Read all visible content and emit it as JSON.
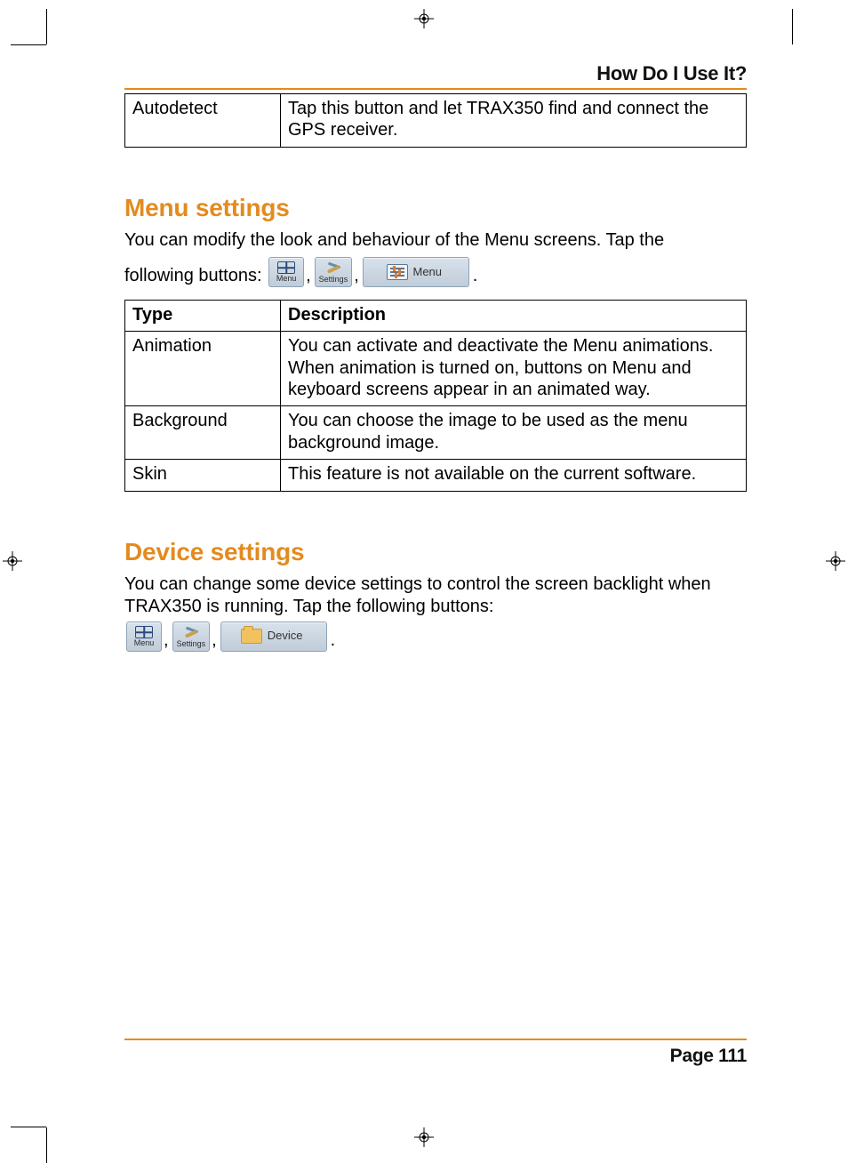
{
  "header": {
    "section_title": "How Do I Use It?"
  },
  "autodetect_table": {
    "rows": [
      {
        "type": "Autodetect",
        "desc": "Tap this button and let TRAX350 find and connect the GPS receiver."
      }
    ]
  },
  "menu_settings": {
    "heading": "Menu settings",
    "intro_line1": "You can modify the look and behaviour of the Menu screens. Tap the",
    "intro_line2_prefix": "following buttons: ",
    "buttons": {
      "menu": "Menu",
      "settings": "Settings",
      "menu_wide": "Menu"
    },
    "table": {
      "head_type": "Type",
      "head_desc": "Description",
      "rows": [
        {
          "type": "Animation",
          "desc": "You can activate and deactivate the Menu animations. When animation is turned on, buttons on Menu and keyboard screens appear in an animated way."
        },
        {
          "type": "Background",
          "desc": "You can choose the image to be used as the menu background image."
        },
        {
          "type": "Skin",
          "desc": "This feature is not available on the current software."
        }
      ]
    }
  },
  "device_settings": {
    "heading": "Device settings",
    "intro": "You can change some device settings to control the screen backlight when TRAX350 is running. Tap the following buttons:",
    "buttons": {
      "menu": "Menu",
      "settings": "Settings",
      "device_wide": "Device"
    }
  },
  "footer": {
    "page": "Page 111"
  }
}
